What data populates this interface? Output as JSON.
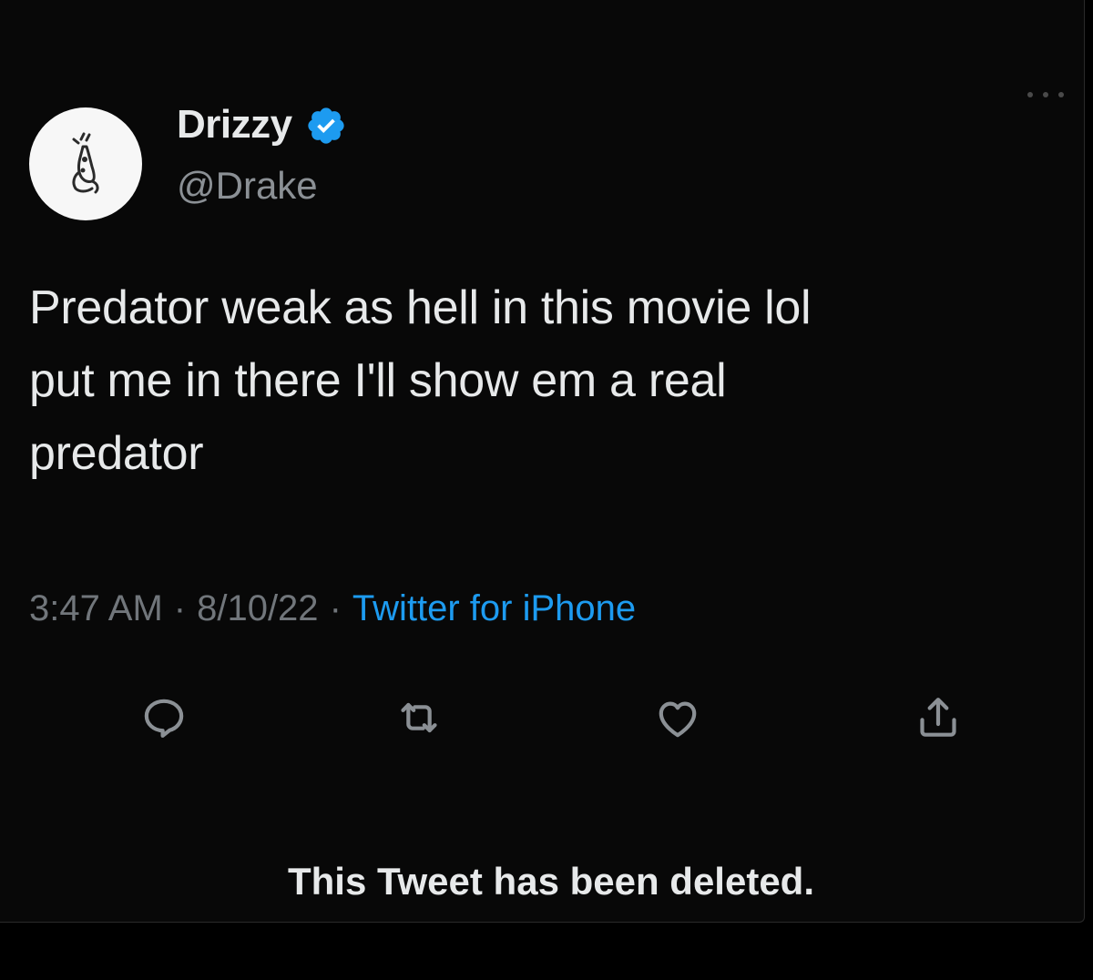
{
  "tweet": {
    "author": {
      "display_name": "Drizzy",
      "handle": "@Drake",
      "verified": true
    },
    "text": "Predator weak as hell in this movie lol\nput me in there I'll show em a real\npredator",
    "meta": {
      "time": "3:47 AM",
      "separator": "·",
      "date": "8/10/22",
      "source": "Twitter for iPhone"
    },
    "actions": [
      "reply-icon",
      "retweet-icon",
      "like-icon",
      "share-icon"
    ],
    "deleted_notice": "This Tweet has been deleted."
  },
  "colors": {
    "background": "#080808",
    "text_primary": "#e7e9ea",
    "text_secondary": "#71767b",
    "accent": "#1d9bf0",
    "verified_badge": "#1d9bf0"
  }
}
